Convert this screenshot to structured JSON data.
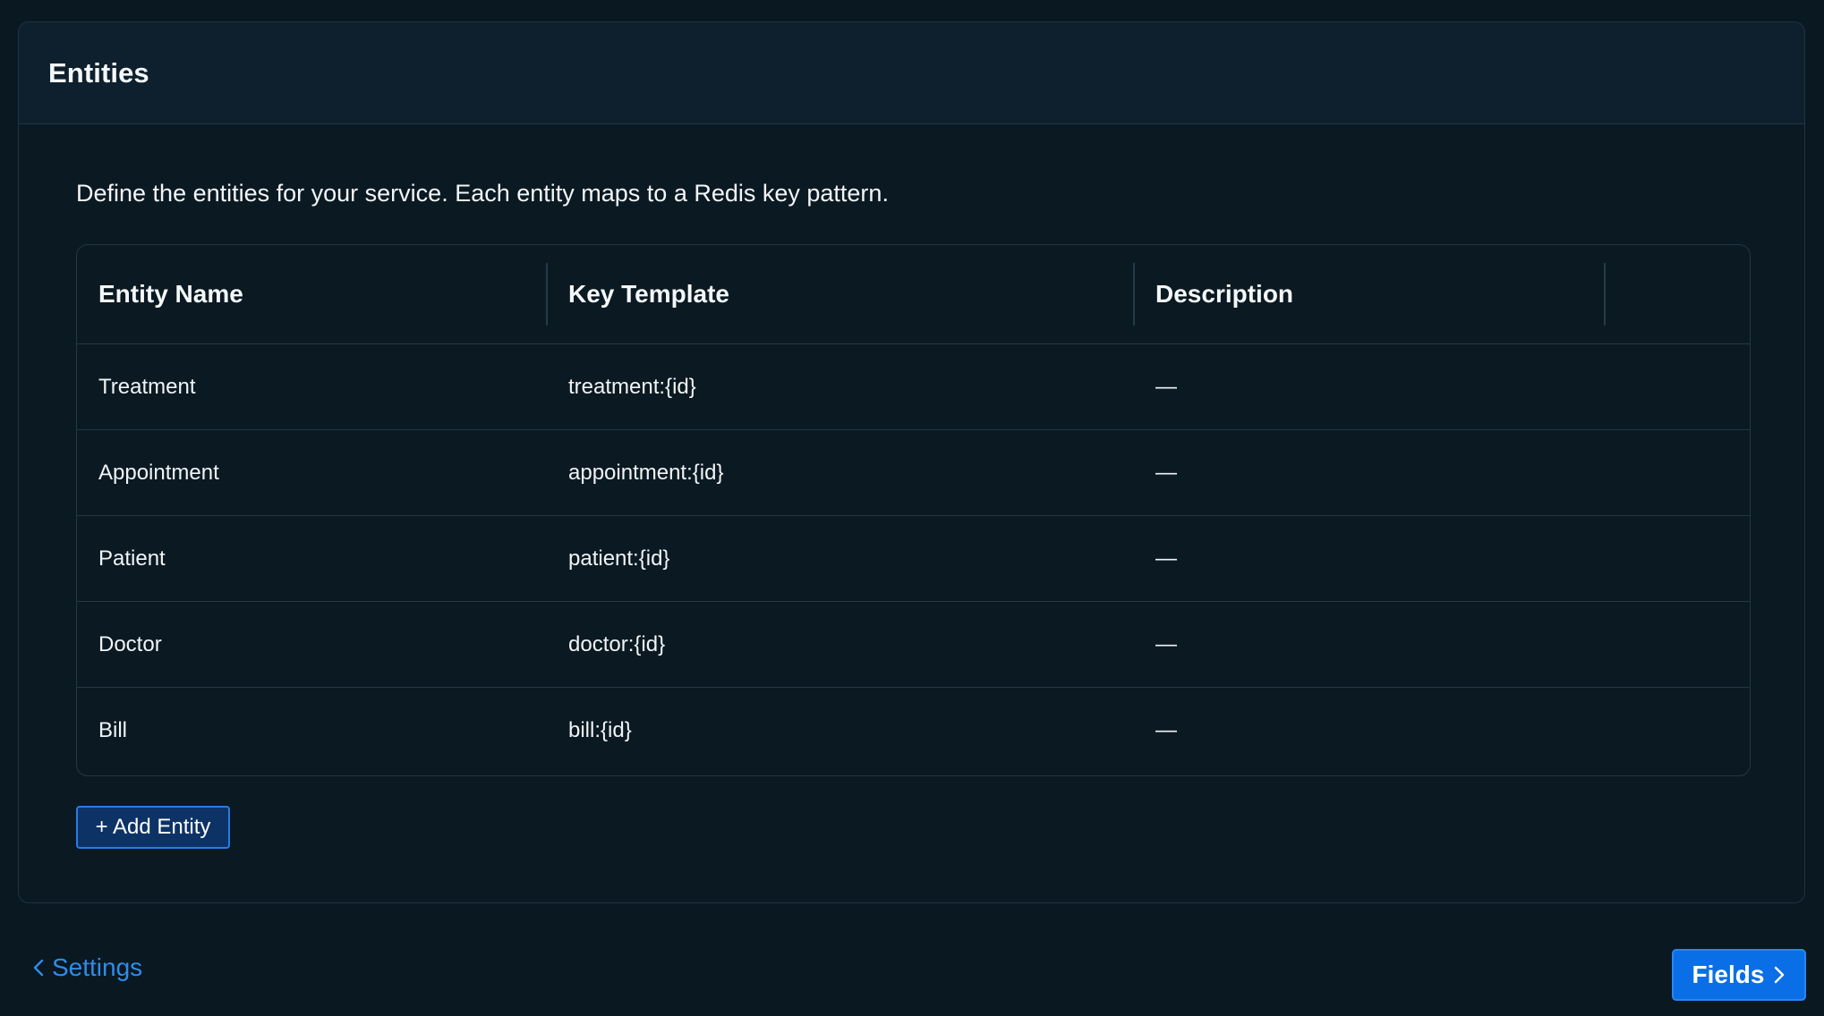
{
  "panel": {
    "title": "Entities",
    "description": "Define the entities for your service. Each entity maps to a Redis key pattern."
  },
  "table": {
    "headers": [
      "Entity Name",
      "Key Template",
      "Description",
      ""
    ],
    "rows": [
      {
        "name": "Treatment",
        "key": "treatment:{id}",
        "description": "—"
      },
      {
        "name": "Appointment",
        "key": "appointment:{id}",
        "description": "—"
      },
      {
        "name": "Patient",
        "key": "patient:{id}",
        "description": "—"
      },
      {
        "name": "Doctor",
        "key": "doctor:{id}",
        "description": "—"
      },
      {
        "name": "Bill",
        "key": "bill:{id}",
        "description": "—"
      }
    ]
  },
  "actions": {
    "add_entity_label": "+ Add Entity"
  },
  "navigation": {
    "back_label": "Settings",
    "back_icon": "chevron-left-icon",
    "next_label": "Fields",
    "next_icon": "chevron-right-icon"
  },
  "colors": {
    "background": "#0a1822",
    "panel_header": "#0e202d",
    "accent": "#0a6fe6",
    "link": "#2f8de8"
  }
}
